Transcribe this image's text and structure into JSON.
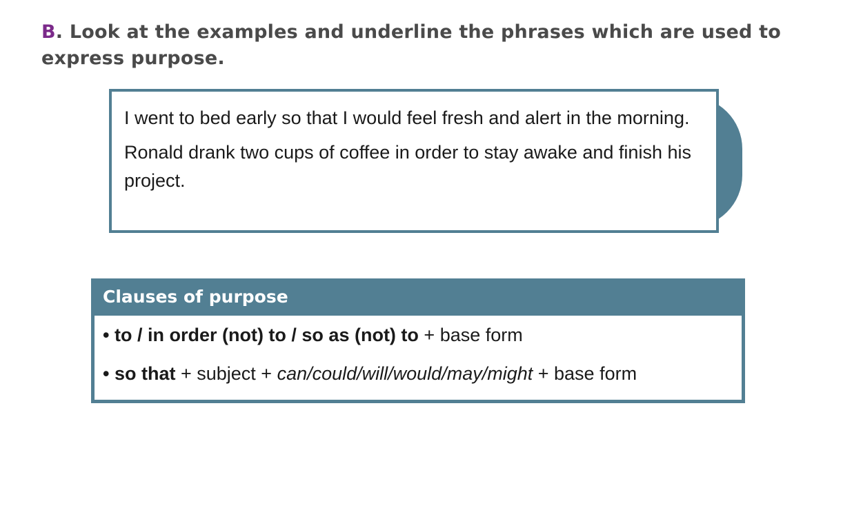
{
  "instruction": {
    "letter": "B",
    "text_line1": ". Look at the examples and underline the phrases which are used to",
    "text_line2": "express purpose."
  },
  "examples": [
    "I went to bed early so that I would feel fresh and alert in the morning.",
    "Ronald drank two cups of coffee in order to stay awake and finish his project."
  ],
  "grammar": {
    "title": "Clauses of purpose",
    "rules": [
      {
        "bullet": "•",
        "bold": "to / in order (not) to / so as (not) to",
        "rest": " + base form"
      },
      {
        "bullet": "•",
        "bold": "so that",
        "pre_italic": " + subject + ",
        "italic": "can/could/will/would/may/might",
        "rest": " + base form"
      }
    ]
  },
  "colors": {
    "accent": "#527f93",
    "letter": "#7b2a8a",
    "heading_text": "#4a4a4a"
  }
}
